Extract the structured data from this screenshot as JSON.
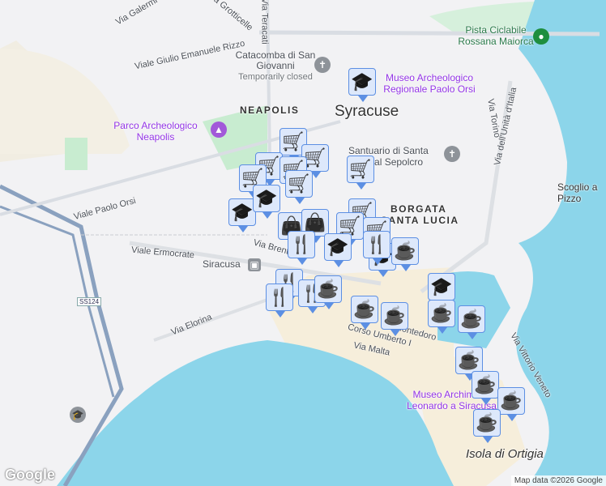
{
  "map": {
    "city": "Syracuse",
    "districts": [
      "NEAPOLIS",
      "BORGATA",
      "SANTA LUCIA"
    ],
    "streets": [
      "Via Galermi",
      "Via Grotticelle",
      "Via Teracati",
      "Viale Giulio Emanuele Rizzo",
      "Viale Paolo Orsi",
      "Viale Ermocrate",
      "Via Brenta",
      "Via Elorina",
      "Corso Umberto I",
      "Via Malta",
      "Via Montedoro",
      "Via Torino",
      "Via dell'Unità d'Italia",
      "Via Vittorio Veneto"
    ],
    "road_shield": "SS124",
    "pois": {
      "catacomba": "Catacomba di San Giovanni",
      "catacomba_status": "Temporarily closed",
      "museo_orsi": "Museo Archeologico Regionale Paolo Orsi",
      "parco": "Parco Archeologico Neapolis",
      "santuario": "Santuario di Santa Lucia al Sepolcro",
      "pista": "Pista Ciclabile Rossana Maiorca",
      "museo_arch": "Museo Archimede Leonardo a Siracusa",
      "station": "Siracusa",
      "scoglio": "Scoglio a Pizzo",
      "ortigia": "Isola di Ortigia"
    },
    "attribution": "Map data ©2026 Google",
    "logo": "Google",
    "colors": {
      "water": "#8cd5ea",
      "land": "#f2f2f4",
      "old_town": "#f6eedb",
      "park": "#c8ecd0",
      "marker_bg": "#dde8fb",
      "marker_border": "#5c8fe3",
      "marker_icon": "#0e3f63"
    }
  },
  "markers": [
    "cart",
    "cart",
    "cart",
    "cart",
    "cart",
    "cart",
    "cart",
    "cart",
    "cart",
    "cart",
    "bag",
    "bag",
    "education",
    "education",
    "education",
    "education",
    "education",
    "education",
    "fork-knife",
    "fork-knife",
    "fork-knife",
    "fork-knife",
    "fork-knife",
    "coffee",
    "coffee",
    "coffee",
    "coffee",
    "coffee",
    "coffee",
    "coffee",
    "coffee",
    "coffee",
    "coffee"
  ]
}
